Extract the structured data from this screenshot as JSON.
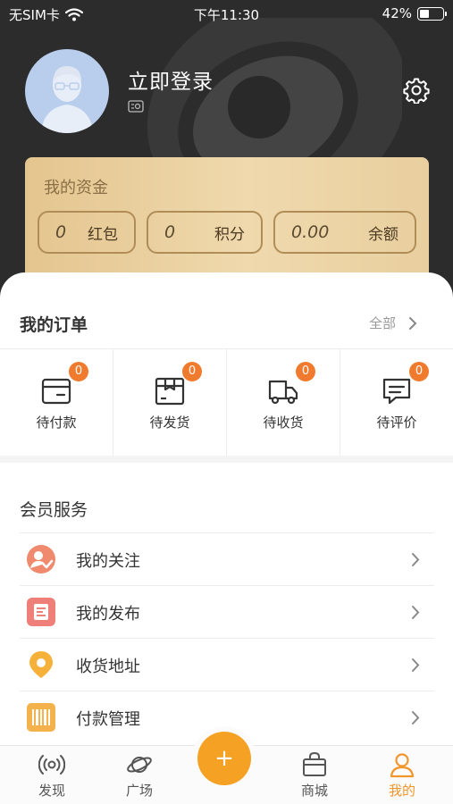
{
  "status_bar": {
    "carrier": "无SIM卡",
    "time": "下午11:30",
    "battery": "42%",
    "battery_level": 0.42
  },
  "profile": {
    "login_label": "立即登录"
  },
  "funds": {
    "title": "我的资金",
    "items": [
      {
        "value": "0",
        "label": "红包"
      },
      {
        "value": "0",
        "label": "积分"
      },
      {
        "value": "0.00",
        "label": "余额"
      }
    ]
  },
  "orders": {
    "title": "我的订单",
    "all_label": "全部",
    "items": [
      {
        "label": "待付款",
        "badge": "0",
        "icon": "wallet-icon"
      },
      {
        "label": "待发货",
        "badge": "0",
        "icon": "package-icon"
      },
      {
        "label": "待收货",
        "badge": "0",
        "icon": "truck-icon"
      },
      {
        "label": "待评价",
        "badge": "0",
        "icon": "comment-icon"
      }
    ]
  },
  "member": {
    "title": "会员服务",
    "items": [
      {
        "label": "我的关注",
        "icon": "follow-icon",
        "color": "#ef8a6e"
      },
      {
        "label": "我的发布",
        "icon": "publish-icon",
        "color": "#ee7f79"
      },
      {
        "label": "收货地址",
        "icon": "location-icon",
        "color": "#f6b13a"
      },
      {
        "label": "付款管理",
        "icon": "barcode-icon",
        "color": "#f3b24b"
      }
    ]
  },
  "tabs": [
    {
      "label": "发现",
      "icon": "radar-icon"
    },
    {
      "label": "广场",
      "icon": "planet-icon"
    },
    {
      "label": "商城",
      "icon": "bag-icon"
    },
    {
      "label": "我的",
      "icon": "user-icon",
      "active": true
    }
  ],
  "fab": {
    "symbol": "+"
  },
  "colors": {
    "accent": "#f0962a",
    "badge": "#f07b2f",
    "hero_bg": "#2d2c2c"
  }
}
